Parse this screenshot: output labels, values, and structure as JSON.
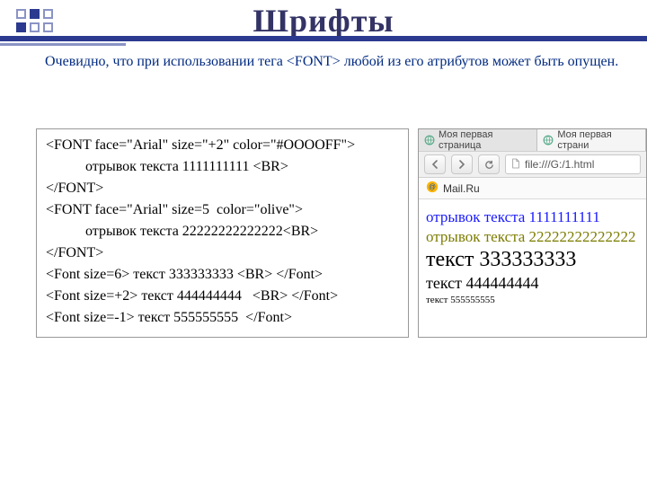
{
  "title": "Шрифты",
  "intro": "Очевидно, что при использовании тега <FONT> любой из его атрибутов может быть опущен.",
  "code": {
    "l1": "<FONT face=\"Arial\" size=\"+2\" color=\"#OOOOFF\">",
    "l2": "отрывок текста 1111111111 <BR>",
    "l3": "</FONT>",
    "l4": "",
    "l5": "<FONT face=\"Arial\" size=5  color=\"olive\">",
    "l6": "отрывок текста 22222222222222<BR>",
    "l7": "</FONT>",
    "l8": "<Font size=6> текст 333333333 <BR> </Font>",
    "l9": "<Font size=+2> текст 444444444   <BR> </Font>",
    "l10": "<Font size=-1> текст 555555555  </Font>"
  },
  "browser": {
    "tab1": "Моя первая страница",
    "tab2": "Моя первая страни",
    "url": "file:///G:/1.html",
    "bookmark": "Mail.Ru"
  },
  "rendered": {
    "r1": "отрывок текста 1111111111",
    "r2": "отрывок текста 22222222222222",
    "r3": "текст 333333333",
    "r4": "текст 444444444",
    "r5": "текст 555555555"
  }
}
